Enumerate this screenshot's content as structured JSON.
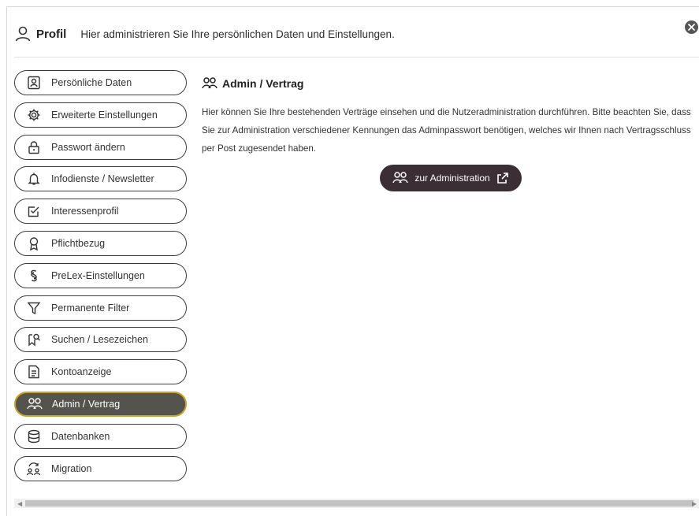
{
  "header": {
    "icon": "user-icon",
    "title": "Profil",
    "subtitle": "Hier administrieren Sie Ihre persönlichen Daten und Einstellungen.",
    "close_icon": "close-icon"
  },
  "sidebar": {
    "items": [
      {
        "label": "Persönliche Daten",
        "icon": "id-card-icon"
      },
      {
        "label": "Erweiterte Einstellungen",
        "icon": "gear-icon"
      },
      {
        "label": "Passwort ändern",
        "icon": "lock-icon"
      },
      {
        "label": "Infodienste / Newsletter",
        "icon": "bell-icon"
      },
      {
        "label": "Interessenprofil",
        "icon": "checkbox-icon"
      },
      {
        "label": "Pflichtbezug",
        "icon": "award-icon"
      },
      {
        "label": "PreLex-Einstellungen",
        "icon": "paragraph-icon"
      },
      {
        "label": "Permanente Filter",
        "icon": "filter-icon"
      },
      {
        "label": "Suchen / Lesezeichen",
        "icon": "bookmark-search-icon"
      },
      {
        "label": "Kontoanzeige",
        "icon": "document-icon"
      },
      {
        "label": "Admin / Vertrag",
        "icon": "users-icon",
        "active": true
      },
      {
        "label": "Datenbanken",
        "icon": "database-icon"
      },
      {
        "label": "Migration",
        "icon": "migration-icon"
      }
    ]
  },
  "content": {
    "title": "Admin / Vertrag",
    "text": "Hier können Sie Ihre bestehenden Verträge einsehen und die Nutzeradministration durchführen. Bitte beachten Sie, dass Sie zur Administration verschiedener Kennungen das Adminpasswort benötigen, welches wir Ihnen nach Vertragsschluss per Post zugesendet haben.",
    "button_label": "zur Administration"
  },
  "colors": {
    "active_bg": "#55534e",
    "active_border": "#c9a227",
    "button_bg": "#3c2e35"
  }
}
